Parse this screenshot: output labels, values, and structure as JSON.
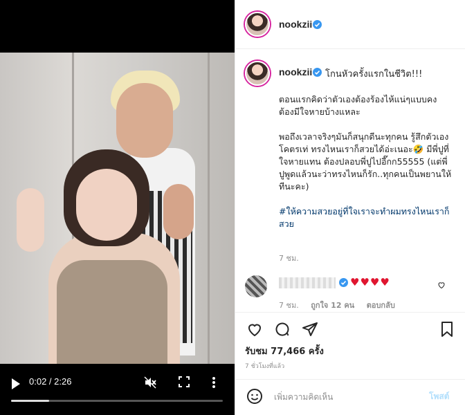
{
  "video": {
    "time": "0:02 / 2:26",
    "progress_fraction": 0.18,
    "icons": {
      "play": "play-icon",
      "mute": "volume-muted-icon",
      "fullscreen": "fullscreen-icon",
      "more": "more-vertical-icon"
    }
  },
  "header": {
    "username": "nookzii"
  },
  "post": {
    "username": "nookzii",
    "caption_head": "โกนหัวครั้งแรกในชีวิต!!!",
    "caption_lines": [
      "ตอนแรกคิดว่าตัวเองต้องร้องไห้แน่ๆแบบคงต้องมีใจหายบ้างแหละ",
      "พอถึงเวลาจริงๆมันก็สนุกดีนะทุกคน รู้สึกตัวเองโคตรเท่ ทรงไหนเราก็สวยได้อ่ะเนอะ🤣 มีพี่ปูที่ใจหายแทน ต้องปลอบพี่ปูไปอี๊กก55555 (แต่พี่ปูพูดแล้วนะว่าทรงไหนก็รัก..ทุกคนเป็นพยานให้ทีนะคะ)"
    ],
    "hashtag": "#ให้ความสวยอยู่ที่ใจเราจะทำผมทรงไหนเราก็สวย",
    "time": "7 ชม."
  },
  "comment": {
    "hearts": "♥♥♥♥",
    "time": "7 ชม.",
    "likes": "ถูกใจ 12 คน",
    "reply": "ตอบกลับ"
  },
  "actions": {
    "likes": "รับชม 77,466 ครั้ง",
    "ago": "7 ชั่วโมงที่แล้ว",
    "icons": [
      "heart-icon",
      "comment-icon",
      "share-icon",
      "bookmark-icon"
    ]
  },
  "add_comment": {
    "placeholder": "เพิ่มความคิดเห็น",
    "post_label": "โพสต์"
  },
  "colors": {
    "verified": "#3897f0",
    "link": "#00376b",
    "post_button": "#b2dffc",
    "hearts": "#e0152f"
  }
}
